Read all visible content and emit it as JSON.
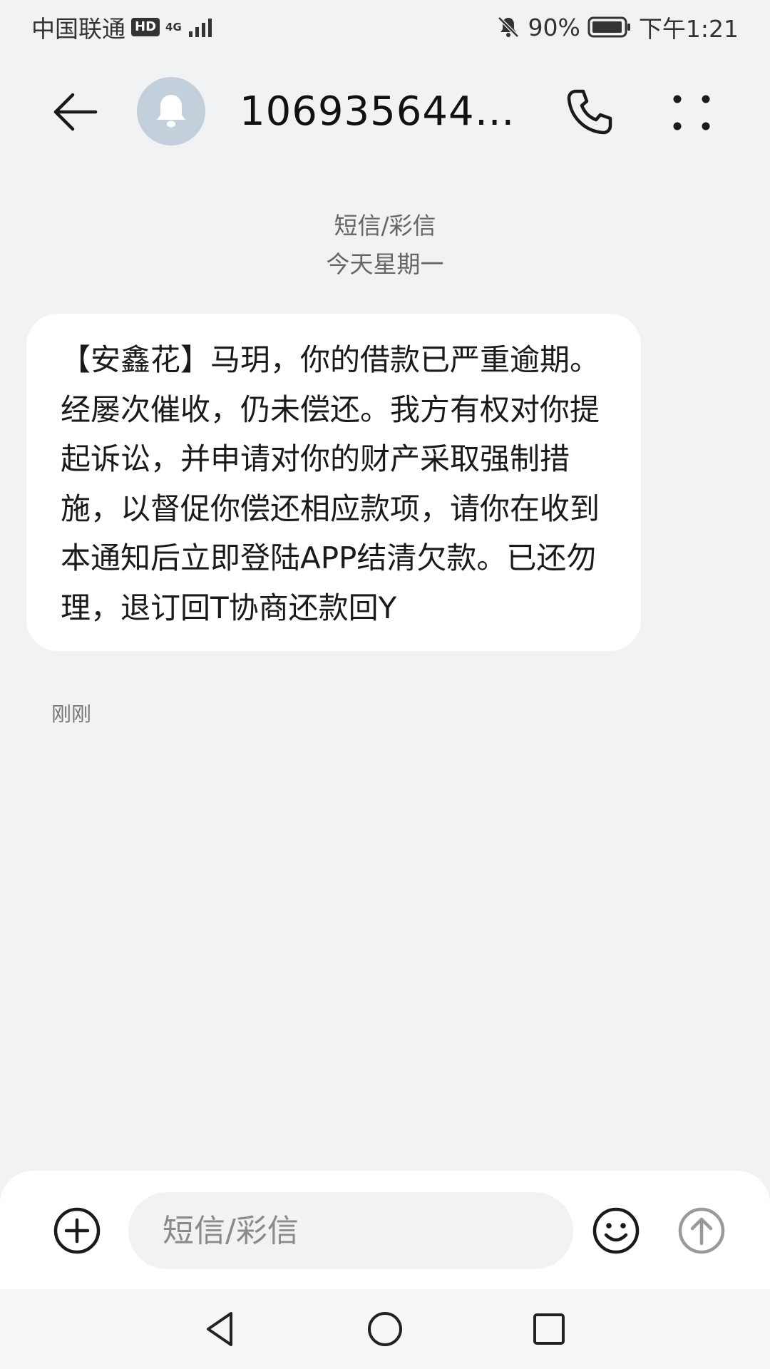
{
  "status_bar": {
    "carrier": "中国联通",
    "hd_badge": "HD",
    "network_type": "4G",
    "battery_percent": "90%",
    "time": "下午1:21"
  },
  "header": {
    "contact_title": "1069356444...",
    "icons": {
      "back": "arrow-left-icon",
      "avatar": "bell-icon",
      "call": "phone-icon",
      "more": "more-dots-icon"
    }
  },
  "conversation": {
    "type_label": "短信/彩信",
    "date_label": "今天星期一"
  },
  "messages": [
    {
      "text": "【安鑫花】马玥，你的借款已严重逾期。经屡次催收，仍未偿还。我方有权对你提起诉讼，并申请对你的财产采取强制措施，以督促你偿还相应款项，请你在收到本通知后立即登陆APP结清欠款。已还勿理，退订回T协商还款回Y",
      "time": "刚刚"
    }
  ],
  "input_bar": {
    "placeholder": "短信/彩信",
    "value": ""
  },
  "colors": {
    "background": "#f1f2f4",
    "bubble": "#ffffff",
    "avatar": "#c4cfdc",
    "secondary_text": "#666666"
  }
}
